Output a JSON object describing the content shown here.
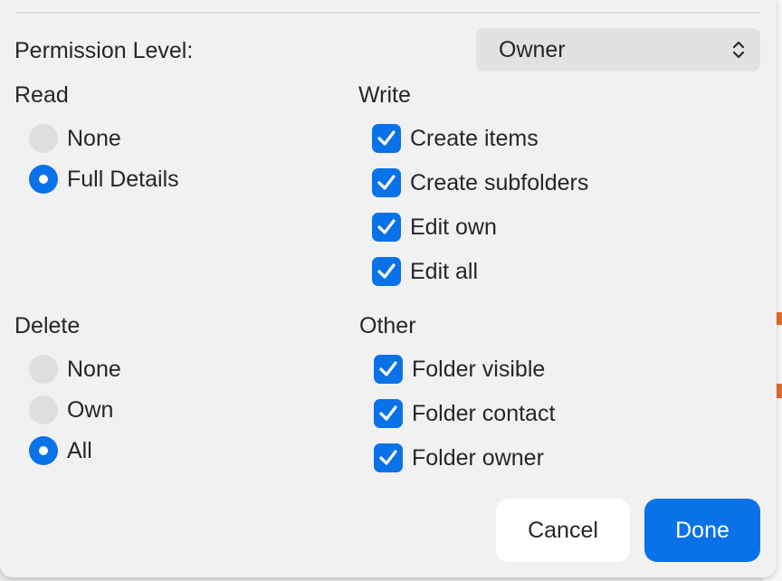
{
  "permission": {
    "label": "Permission Level:",
    "value": "Owner"
  },
  "read": {
    "title": "Read",
    "options": [
      {
        "label": "None",
        "selected": false
      },
      {
        "label": "Full Details",
        "selected": true
      }
    ]
  },
  "write": {
    "title": "Write",
    "items": [
      {
        "label": "Create items",
        "checked": true
      },
      {
        "label": "Create subfolders",
        "checked": true
      },
      {
        "label": "Edit own",
        "checked": true
      },
      {
        "label": "Edit all",
        "checked": true
      }
    ]
  },
  "delete": {
    "title": "Delete",
    "options": [
      {
        "label": "None",
        "selected": false
      },
      {
        "label": "Own",
        "selected": false
      },
      {
        "label": "All",
        "selected": true
      }
    ]
  },
  "other": {
    "title": "Other",
    "items": [
      {
        "label": "Folder visible",
        "checked": true
      },
      {
        "label": "Folder contact",
        "checked": true
      },
      {
        "label": "Folder owner",
        "checked": true
      }
    ]
  },
  "buttons": {
    "cancel": "Cancel",
    "done": "Done"
  },
  "colors": {
    "accent": "#0a72e8",
    "background": "#f1f1f1"
  },
  "icons": {
    "select": "chevron-up-down-icon",
    "check": "checkmark-icon"
  }
}
